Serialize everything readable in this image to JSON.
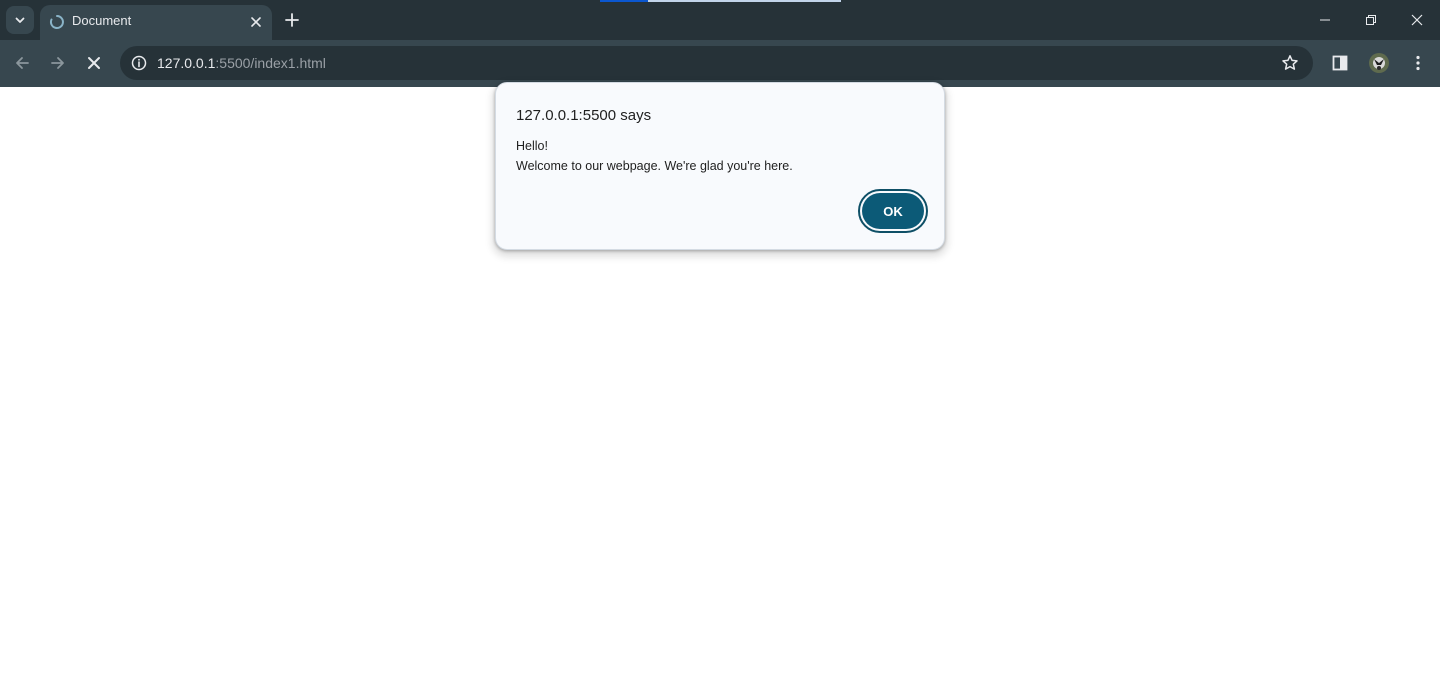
{
  "tab": {
    "title": "Document"
  },
  "address_bar": {
    "host": "127.0.0.1",
    "path": ":5500/index1.html"
  },
  "dialog": {
    "title": "127.0.0.1:5500 says",
    "lines": [
      "Hello!",
      "Welcome to our webpage. We're glad you're here."
    ],
    "ok_label": "OK"
  },
  "colors": {
    "tabstrip": "#263238",
    "toolbar": "#37474f",
    "dialog_bg": "#f8fafd",
    "ok_button": "#0c5a77"
  },
  "icons": [
    "tab-search-icon",
    "loading-spinner-icon",
    "close-icon",
    "plus-icon",
    "minimize-icon",
    "restore-icon",
    "back-arrow-icon",
    "forward-arrow-icon",
    "stop-icon",
    "info-icon",
    "star-icon",
    "side-panel-icon",
    "profile-avatar",
    "more-menu-icon"
  ]
}
